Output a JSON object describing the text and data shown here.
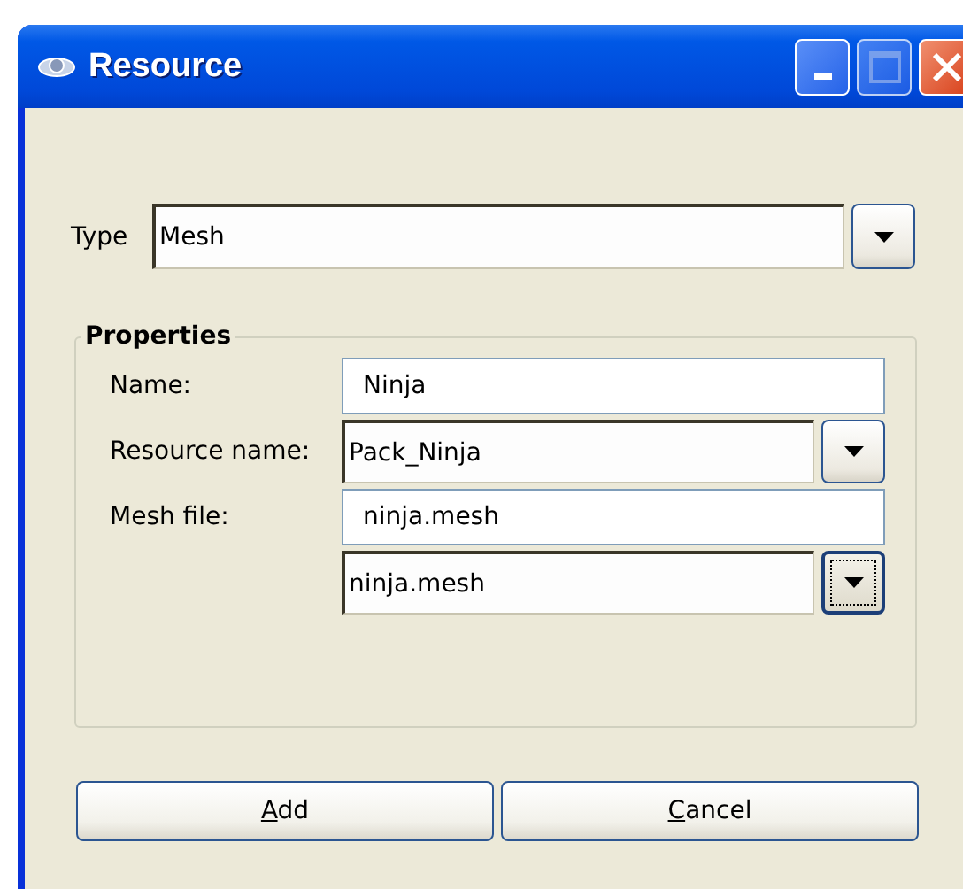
{
  "window": {
    "title": "Resource"
  },
  "type_field": {
    "label": "Type",
    "value": "Mesh",
    "focused": false
  },
  "properties": {
    "title": "Properties",
    "rows": [
      {
        "kind": "text",
        "label": "Name:",
        "value": "Ninja"
      },
      {
        "kind": "combo",
        "label": "Resource name:",
        "value": "Pack_Ninja",
        "focused": false
      },
      {
        "kind": "text",
        "label": "Mesh file:",
        "value": "ninja.mesh"
      },
      {
        "kind": "combo",
        "value": "ninja.mesh",
        "focused": true
      }
    ]
  },
  "buttons": [
    {
      "label": "Add",
      "mnemonic": true
    },
    {
      "label": "Cancel",
      "mnemonic": true
    }
  ]
}
